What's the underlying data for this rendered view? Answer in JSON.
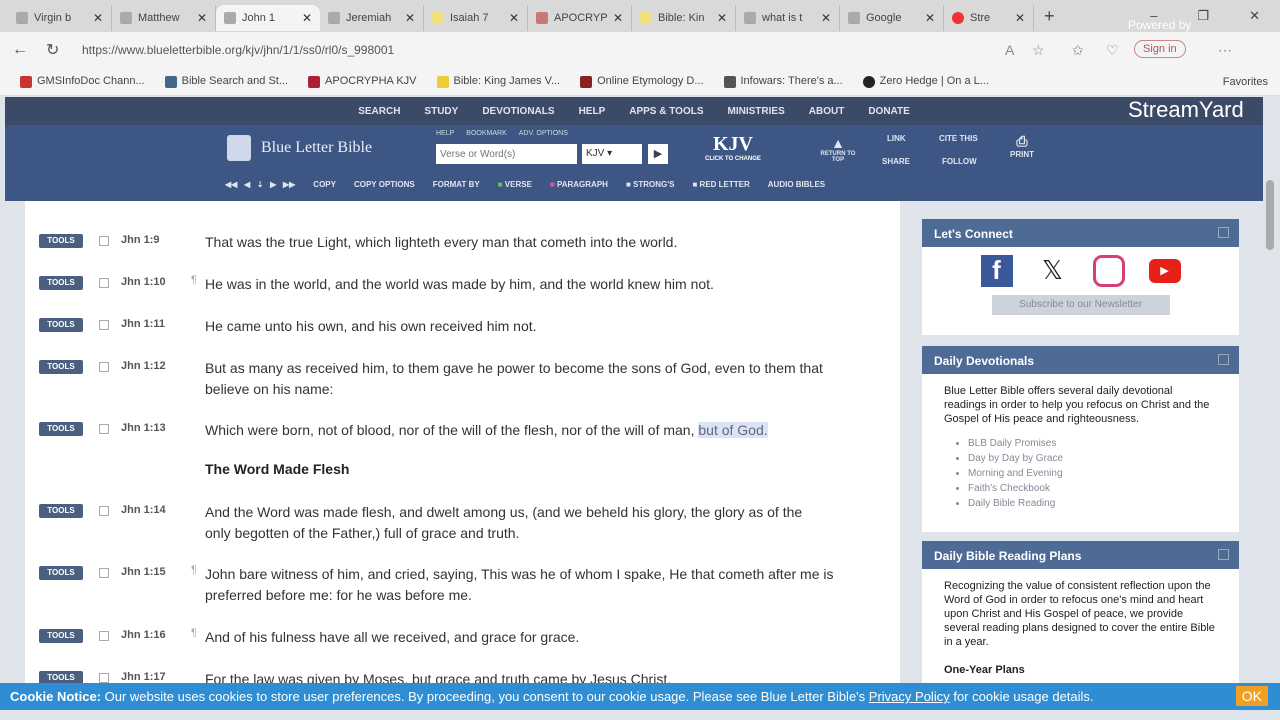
{
  "tabs": [
    "Virgin b",
    "Matthew",
    "John 1",
    "Jeremiah",
    "Isaiah 7",
    "APOCRYPHA",
    "Bible: Kin",
    "what is t",
    "Google",
    "Stre"
  ],
  "address": {
    "url": "https://www.blueletterbible.org/kjv/jhn/1/1/ss0/rl0/s_998001",
    "signin": "Sign in"
  },
  "bookmarks": [
    "GMSInfoDoc Chann...",
    "Bible Search and St...",
    "APOCRYPHA KJV",
    "Bible: King James V...",
    "Online Etymology D...",
    "Infowars: There's a...",
    "Zero Hedge | On a L...",
    "Favorites"
  ],
  "site": {
    "topnav": [
      "SEARCH",
      "STUDY",
      "DEVOTIONALS",
      "HELP",
      "APPS & TOOLS",
      "MINISTRIES",
      "ABOUT",
      "DONATE"
    ],
    "logo": "Blue Letter Bible",
    "minilinks": [
      "HELP",
      "BOOKMARK",
      "ADV. OPTIONS"
    ],
    "search_placeholder": "Verse or Word(s)",
    "version": "KJV",
    "kjv": "KJV",
    "kjv_sub": "CLICK TO CHANGE",
    "return": "RETURN TO TOP",
    "link": "LINK",
    "share": "SHARE",
    "cite": "CITE THIS",
    "follow": "FOLLOW",
    "print": "PRINT",
    "subbar": [
      "COPY",
      "COPY OPTIONS",
      "FORMAT BY",
      "VERSE",
      "PARAGRAPH",
      "STRONG'S",
      "RED LETTER",
      "AUDIO BIBLES"
    ]
  },
  "tools_label": "TOOLS",
  "verses": [
    {
      "ref": "Jhn 1:9",
      "text": "That was the true Light, which lighteth every man that cometh into the world."
    },
    {
      "ref": "Jhn 1:10",
      "text": "He was in the world, and the world was made by him, and the world knew him not."
    },
    {
      "ref": "Jhn 1:11",
      "text": "He came unto his own, and his own received him not."
    },
    {
      "ref": "Jhn 1:12",
      "text": "But as many as received him, to them gave he power to become the sons of God, even to them that believe on his name:"
    },
    {
      "ref": "Jhn 1:13",
      "text": "Which were born, not of blood, nor of the will of the flesh, nor of the will of man,",
      "highlight": "but of God."
    },
    {
      "ref": "Jhn 1:14",
      "text": "And the Word was made flesh, and dwelt among us, (and we beheld his glory, the glory as of the only begotten of the Father,) full of grace and truth."
    },
    {
      "ref": "Jhn 1:15",
      "text": "John bare witness of him, and cried, saying, This was he of whom I spake, He that cometh after me is preferred before me: for he was before me."
    },
    {
      "ref": "Jhn 1:16",
      "text": "And of his fulness have all we received, and grace for grace."
    },
    {
      "ref": "Jhn 1:17",
      "text": "For the law was given by Moses, but grace and truth came by Jesus Christ."
    }
  ],
  "heading": "The Word Made Flesh",
  "sidebar": {
    "connect": {
      "title": "Let's Connect",
      "newsletter": "Subscribe to our Newsletter"
    },
    "devotionals": {
      "title": "Daily Devotionals",
      "text": "Blue Letter Bible offers several daily devotional readings in order to help you refocus on Christ and the Gospel of His peace and righteousness.",
      "items": [
        "BLB Daily Promises",
        "Day by Day by Grace",
        "Morning and Evening",
        "Faith's Checkbook",
        "Daily Bible Reading"
      ]
    },
    "plans": {
      "title": "Daily Bible Reading Plans",
      "text": "Recognizing the value of consistent reflection upon the Word of God in order to refocus one's mind and heart upon Christ and His Gospel of peace, we provide several reading plans designed to cover the entire Bible in a year.",
      "sub": "One-Year Plans"
    }
  },
  "cookie": {
    "label": "Cookie Notice:",
    "text": "Our website uses cookies to store user preferences. By proceeding, you consent to our cookie usage. Please see Blue Letter Bible's",
    "link": "Privacy Policy",
    "tail": "for cookie usage details.",
    "ok": "OK"
  },
  "overlay": {
    "powered": "Powered by",
    "brand": "StreamYard"
  }
}
